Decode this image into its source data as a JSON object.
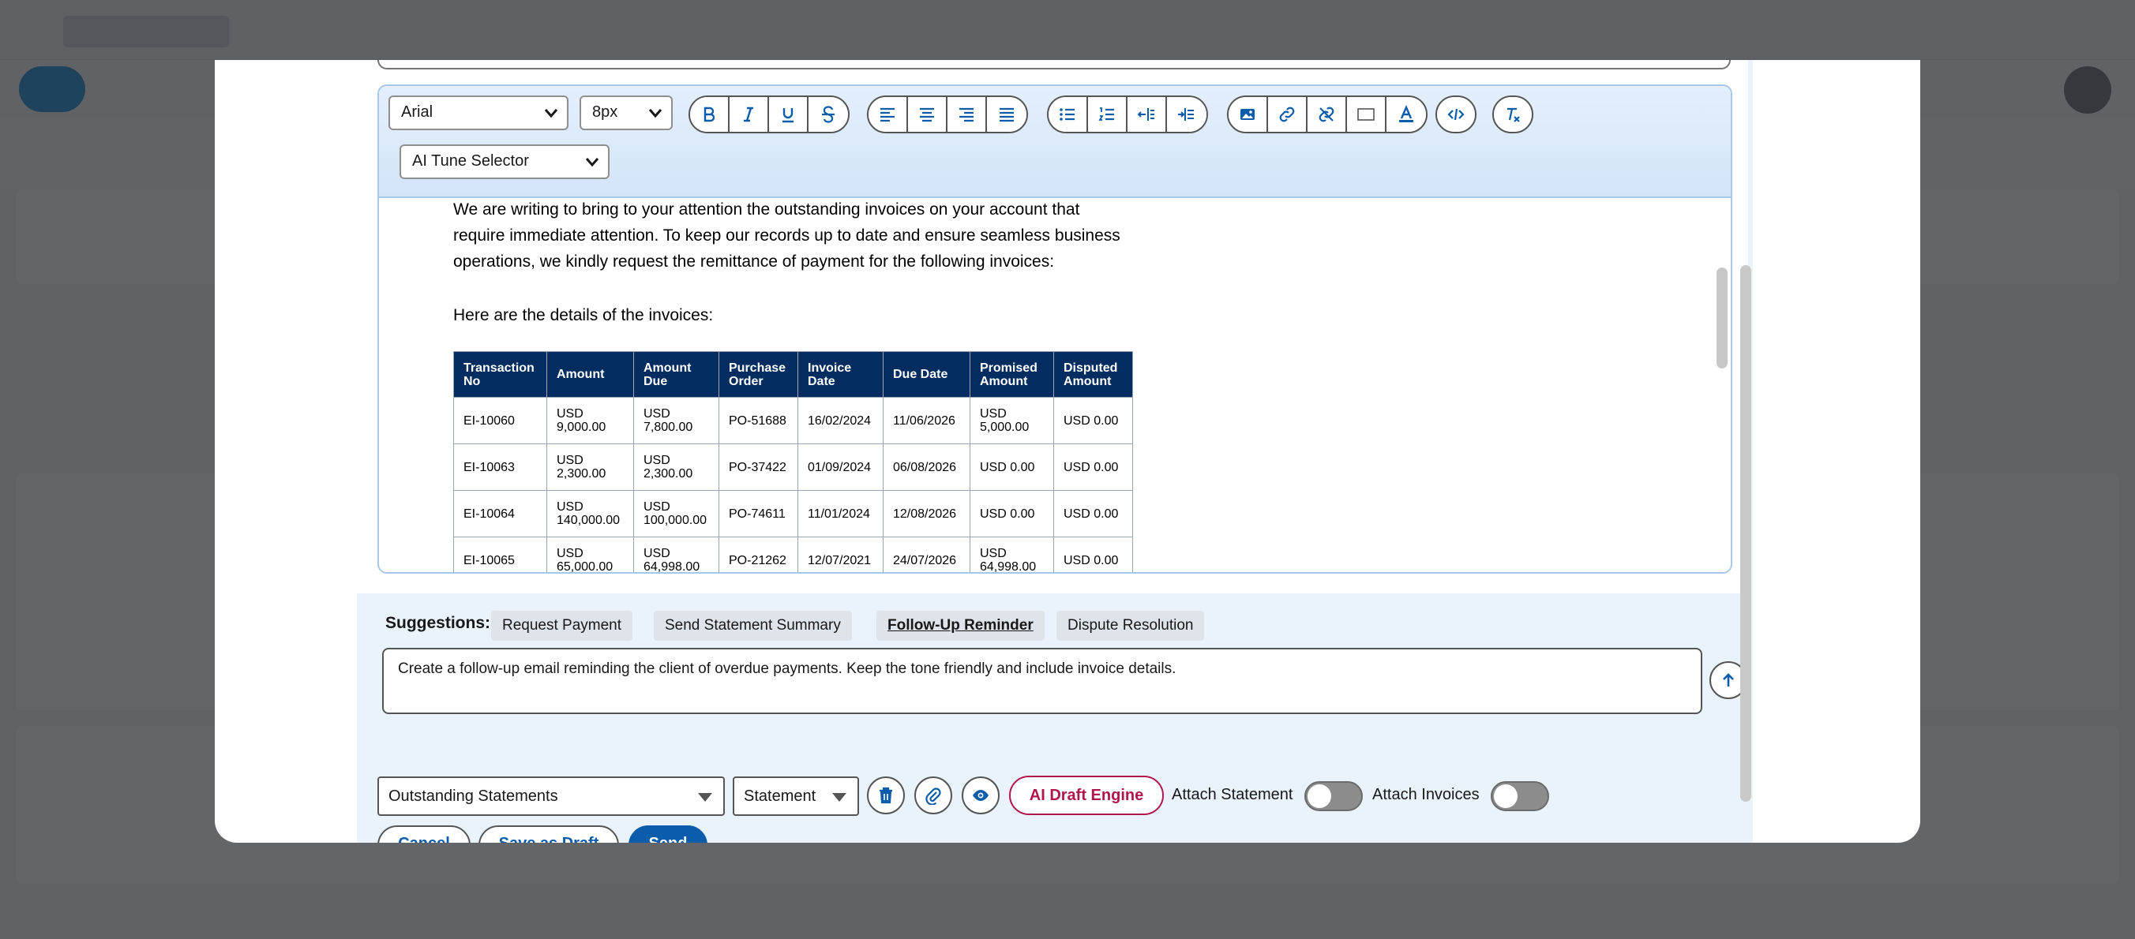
{
  "toolbar": {
    "font_family": "Arial",
    "font_size": "8px",
    "ai_tune_selector": "AI Tune Selector"
  },
  "email_body": {
    "para1_line1": "We are writing to bring to your attention the outstanding invoices on your account that",
    "para1_line2": "require immediate attention. To keep our records up to date and ensure seamless business",
    "para1_line3": "operations, we kindly request the remittance of payment for the following invoices:",
    "para2": "Here are the details of the invoices:"
  },
  "invoice_table": {
    "headers": [
      "Transaction No",
      "Amount",
      "Amount Due",
      "Purchase Order",
      "Invoice Date",
      "Due Date",
      "Promised Amount",
      "Disputed Amount"
    ],
    "rows": [
      [
        "EI-10060",
        "USD 9,000.00",
        "USD 7,800.00",
        "PO-51688",
        "16/02/2024",
        "11/06/2026",
        "USD 5,000.00",
        "USD 0.00"
      ],
      [
        "EI-10063",
        "USD 2,300.00",
        "USD 2,300.00",
        "PO-37422",
        "01/09/2024",
        "06/08/2026",
        "USD 0.00",
        "USD 0.00"
      ],
      [
        "EI-10064",
        "USD 140,000.00",
        "USD 100,000.00",
        "PO-74611",
        "11/01/2024",
        "12/08/2026",
        "USD 0.00",
        "USD 0.00"
      ],
      [
        "EI-10065",
        "USD 65,000.00",
        "USD 64,998.00",
        "PO-21262",
        "12/07/2021",
        "24/07/2026",
        "USD 64,998.00",
        "USD 0.00"
      ]
    ]
  },
  "suggestions": {
    "label": "Suggestions:",
    "chips": [
      "Request Payment",
      "Send Statement Summary",
      "Follow-Up Reminder",
      "Dispute Resolution"
    ]
  },
  "prompt": {
    "value": "Create a follow-up email reminding the client of overdue payments. Keep the tone friendly and include invoice details."
  },
  "controls": {
    "template_select": "Outstanding Statements",
    "type_select": "Statement",
    "ai_draft_engine": "AI Draft Engine",
    "attach_statement": "Attach Statement",
    "attach_invoices": "Attach Invoices",
    "attach_statement_on": false,
    "attach_invoices_on": false
  },
  "footer": {
    "cancel": "Cancel",
    "save_draft": "Save as Draft",
    "send": "Send"
  },
  "colors": {
    "brand": "#0b5cab",
    "table_header": "#032d60",
    "ai_accent": "#b0154d"
  }
}
